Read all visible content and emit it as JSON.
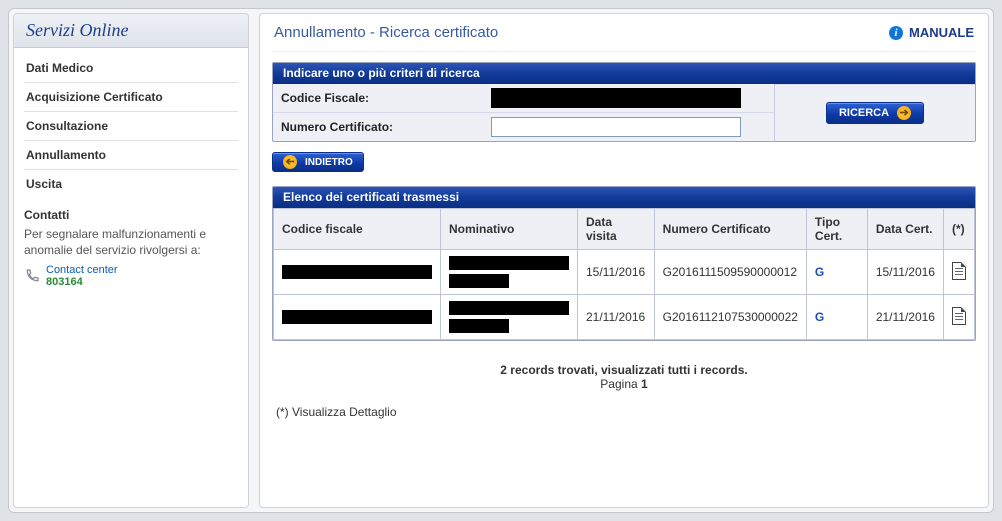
{
  "sidebar": {
    "title": "Servizi Online",
    "items": [
      {
        "label": "Dati Medico"
      },
      {
        "label": "Acquisizione Certificato"
      },
      {
        "label": "Consultazione"
      },
      {
        "label": "Annullamento"
      },
      {
        "label": "Uscita"
      }
    ],
    "contacts": {
      "title": "Contatti",
      "text": "Per segnalare malfunzionamenti e anomalie del servizio rivolgersi a:",
      "center_label": "Contact center",
      "number": "803164"
    }
  },
  "main": {
    "title": "Annullamento - Ricerca certificato",
    "manual": "MANUALE",
    "searchPanel": {
      "title": "Indicare uno o più criteri di ricerca",
      "codiceFiscale_label": "Codice Fiscale:",
      "codiceFiscale_value": "████████████████",
      "numeroCertificato_label": "Numero Certificato:",
      "numeroCertificato_value": "",
      "ricerca_label": "RICERCA",
      "indietro_label": "INDIETRO"
    },
    "resultsPanel": {
      "title": "Elenco dei certificati trasmessi",
      "columns": {
        "codice": "Codice fiscale",
        "nominativo": "Nominativo",
        "dataVisita": "Data visita",
        "numeroCert": "Numero Certificato",
        "tipoCert": "Tipo Cert.",
        "dataCert": "Data Cert.",
        "star": "(*)"
      },
      "rows": [
        {
          "dataVisita": "15/11/2016",
          "numeroCert": "G2016111509590000012",
          "tipoCert": "G",
          "dataCert": "15/11/2016"
        },
        {
          "dataVisita": "21/11/2016",
          "numeroCert": "G2016112107530000022",
          "tipoCert": "G",
          "dataCert": "21/11/2016"
        }
      ],
      "summary": "2 records trovati, visualizzati tutti i records.",
      "page_label": "Pagina ",
      "page_num": "1",
      "legend": "(*) Visualizza Dettaglio"
    }
  }
}
